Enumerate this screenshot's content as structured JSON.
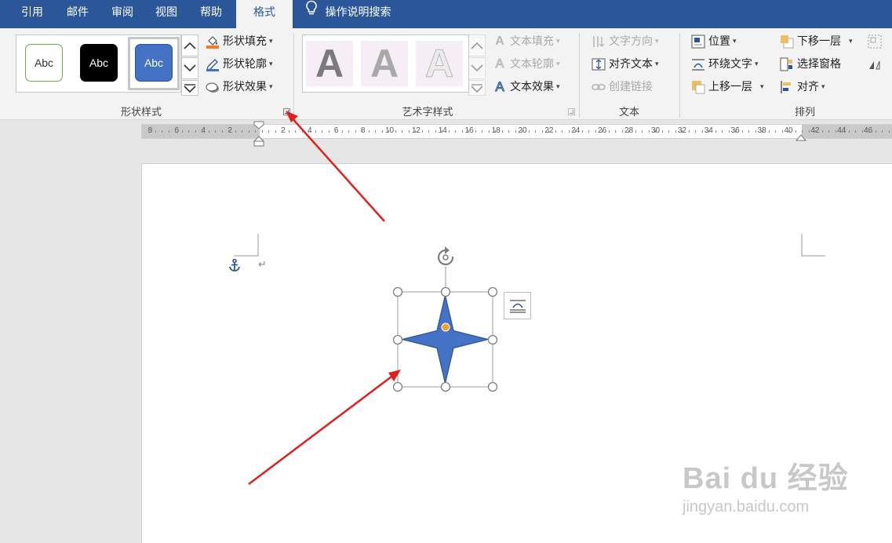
{
  "tabs": [
    {
      "label": "引用",
      "active": false
    },
    {
      "label": "邮件",
      "active": false
    },
    {
      "label": "审阅",
      "active": false
    },
    {
      "label": "视图",
      "active": false
    },
    {
      "label": "帮助",
      "active": false
    },
    {
      "label": "格式",
      "active": true
    }
  ],
  "tell_me": {
    "label": "操作说明搜索",
    "icon": "lightbulb-icon"
  },
  "shape_styles": {
    "group_label": "形状样式",
    "presets": [
      {
        "text": "Abc",
        "fill": "#ffffff",
        "border": "#70ad47",
        "color": "#333333"
      },
      {
        "text": "Abc",
        "fill": "#000000",
        "border": "#000000",
        "color": "#ffffff"
      },
      {
        "text": "Abc",
        "fill": "#4472c4",
        "border": "#2f5597",
        "color": "#ffffff",
        "selected": true
      }
    ],
    "commands": [
      {
        "label": "形状填充",
        "icon": "paint-bucket-icon"
      },
      {
        "label": "形状轮廓",
        "icon": "pen-outline-icon"
      },
      {
        "label": "形状效果",
        "icon": "shape-effects-icon"
      }
    ]
  },
  "wordart_styles": {
    "group_label": "艺术字样式",
    "letters": [
      "A",
      "A",
      "A"
    ],
    "commands": [
      {
        "label": "文本填充",
        "icon": "text-fill-icon",
        "disabled": true
      },
      {
        "label": "文本轮廓",
        "icon": "text-outline-icon",
        "disabled": true
      },
      {
        "label": "文本效果",
        "icon": "text-effects-icon",
        "disabled": false
      }
    ]
  },
  "text_group": {
    "group_label": "文本",
    "commands": [
      {
        "label": "文字方向",
        "icon": "text-direction-icon",
        "disabled": true,
        "dropdown": true
      },
      {
        "label": "对齐文本",
        "icon": "align-text-icon",
        "disabled": false,
        "dropdown": true
      },
      {
        "label": "创建链接",
        "icon": "link-icon",
        "disabled": true,
        "dropdown": false
      }
    ]
  },
  "arrange_group": {
    "group_label": "排列",
    "commands": [
      {
        "label": "位置",
        "icon": "position-icon",
        "dropdown": true
      },
      {
        "label": "环绕文字",
        "icon": "wrap-text-icon",
        "dropdown": true
      },
      {
        "label": "上移一层",
        "icon": "bring-forward-icon",
        "dropdown": true
      },
      {
        "label": "下移一层",
        "icon": "send-backward-icon",
        "dropdown": true
      },
      {
        "label": "选择窗格",
        "icon": "selection-pane-icon",
        "dropdown": false
      },
      {
        "label": "对齐",
        "icon": "align-icon",
        "dropdown": true
      }
    ]
  },
  "ruler": {
    "labels": [
      "8",
      "6",
      "4",
      "2",
      "",
      "2",
      "4",
      "6",
      "8",
      "10",
      "12",
      "14",
      "16",
      "18",
      "20",
      "22",
      "24",
      "26",
      "28",
      "30",
      "32",
      "34",
      "36",
      "38",
      "40",
      "42",
      "44",
      "46"
    ]
  },
  "document": {
    "paragraph_mark": "↵",
    "shape": {
      "type": "four-point-star",
      "fill": "#4472c4",
      "outline": "#2f5597"
    }
  },
  "annotation_color": "#e02020",
  "watermark": {
    "brand": "Bai du 经验",
    "url": "jingyan.baidu.com"
  }
}
